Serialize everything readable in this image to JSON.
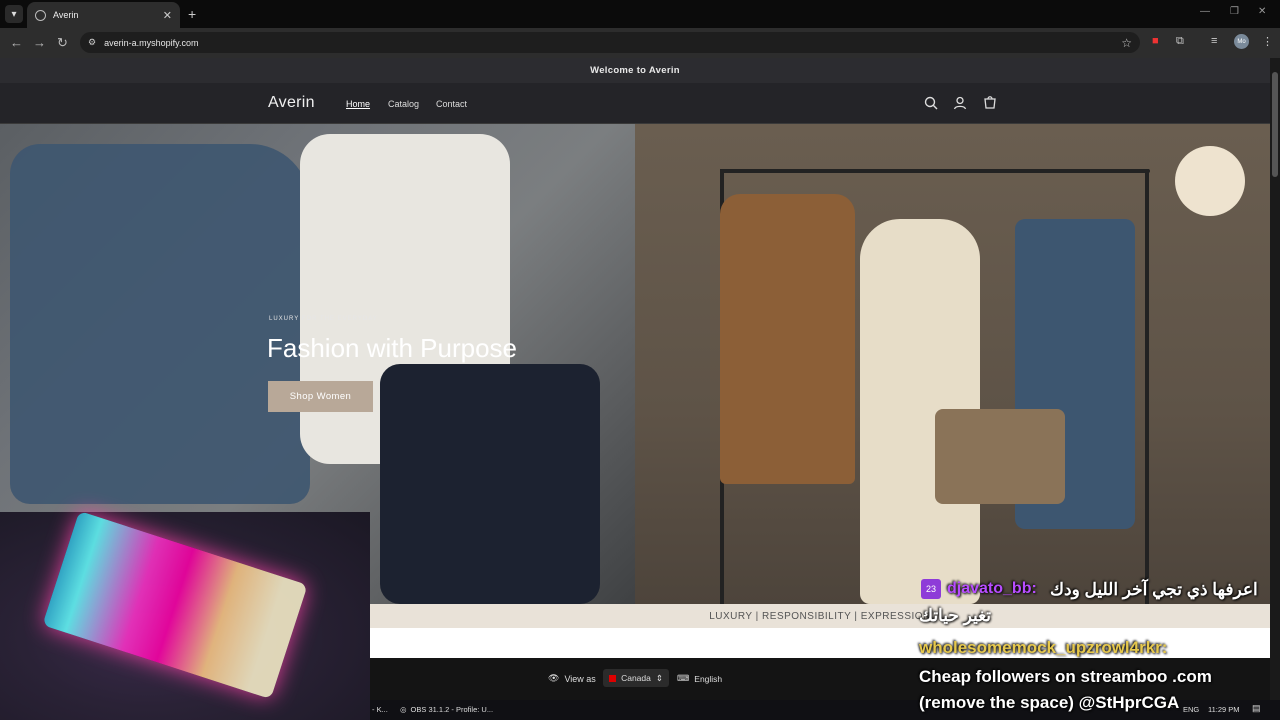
{
  "browser": {
    "tab_title": "Averin",
    "url": "averin-a.myshopify.com",
    "profile_initials": "Mo"
  },
  "store": {
    "announcement": "Welcome to Averin",
    "logo": "Averin",
    "nav": [
      "Home",
      "Catalog",
      "Contact"
    ],
    "icons": [
      "search-icon",
      "account-icon",
      "cart-icon"
    ]
  },
  "hero": {
    "kicker": "LUXURY FOR THE EVERYDAY",
    "title": "Fashion with Purpose",
    "button_label": "Shop Women"
  },
  "marquee": "LUXURY | RESPONSIBILITY | EXPRESSION",
  "preview_bar": {
    "view_as": "View as",
    "country": "Canada",
    "language": "English"
  },
  "taskbar": {
    "item1": "- K...",
    "item2": "OBS 31.1.2 - Profile: U...",
    "lang": "ENG",
    "time": "11:29 PM"
  },
  "chat": {
    "msg1_name": "djavato_bb:",
    "msg1_text": "اعرفها ذي تجي آخر الليل ودك",
    "msg1_text2": "تغير حياتك",
    "msg2_name": "wholesomemock_upzrowl4rkr:",
    "msg2_text": "Cheap followers on streamboo .com (remove the space) @StHprCGA"
  },
  "colors": {
    "header_bg": "#242428",
    "button_bg": "#b8a898",
    "marquee_bg": "#e9e2d8"
  }
}
